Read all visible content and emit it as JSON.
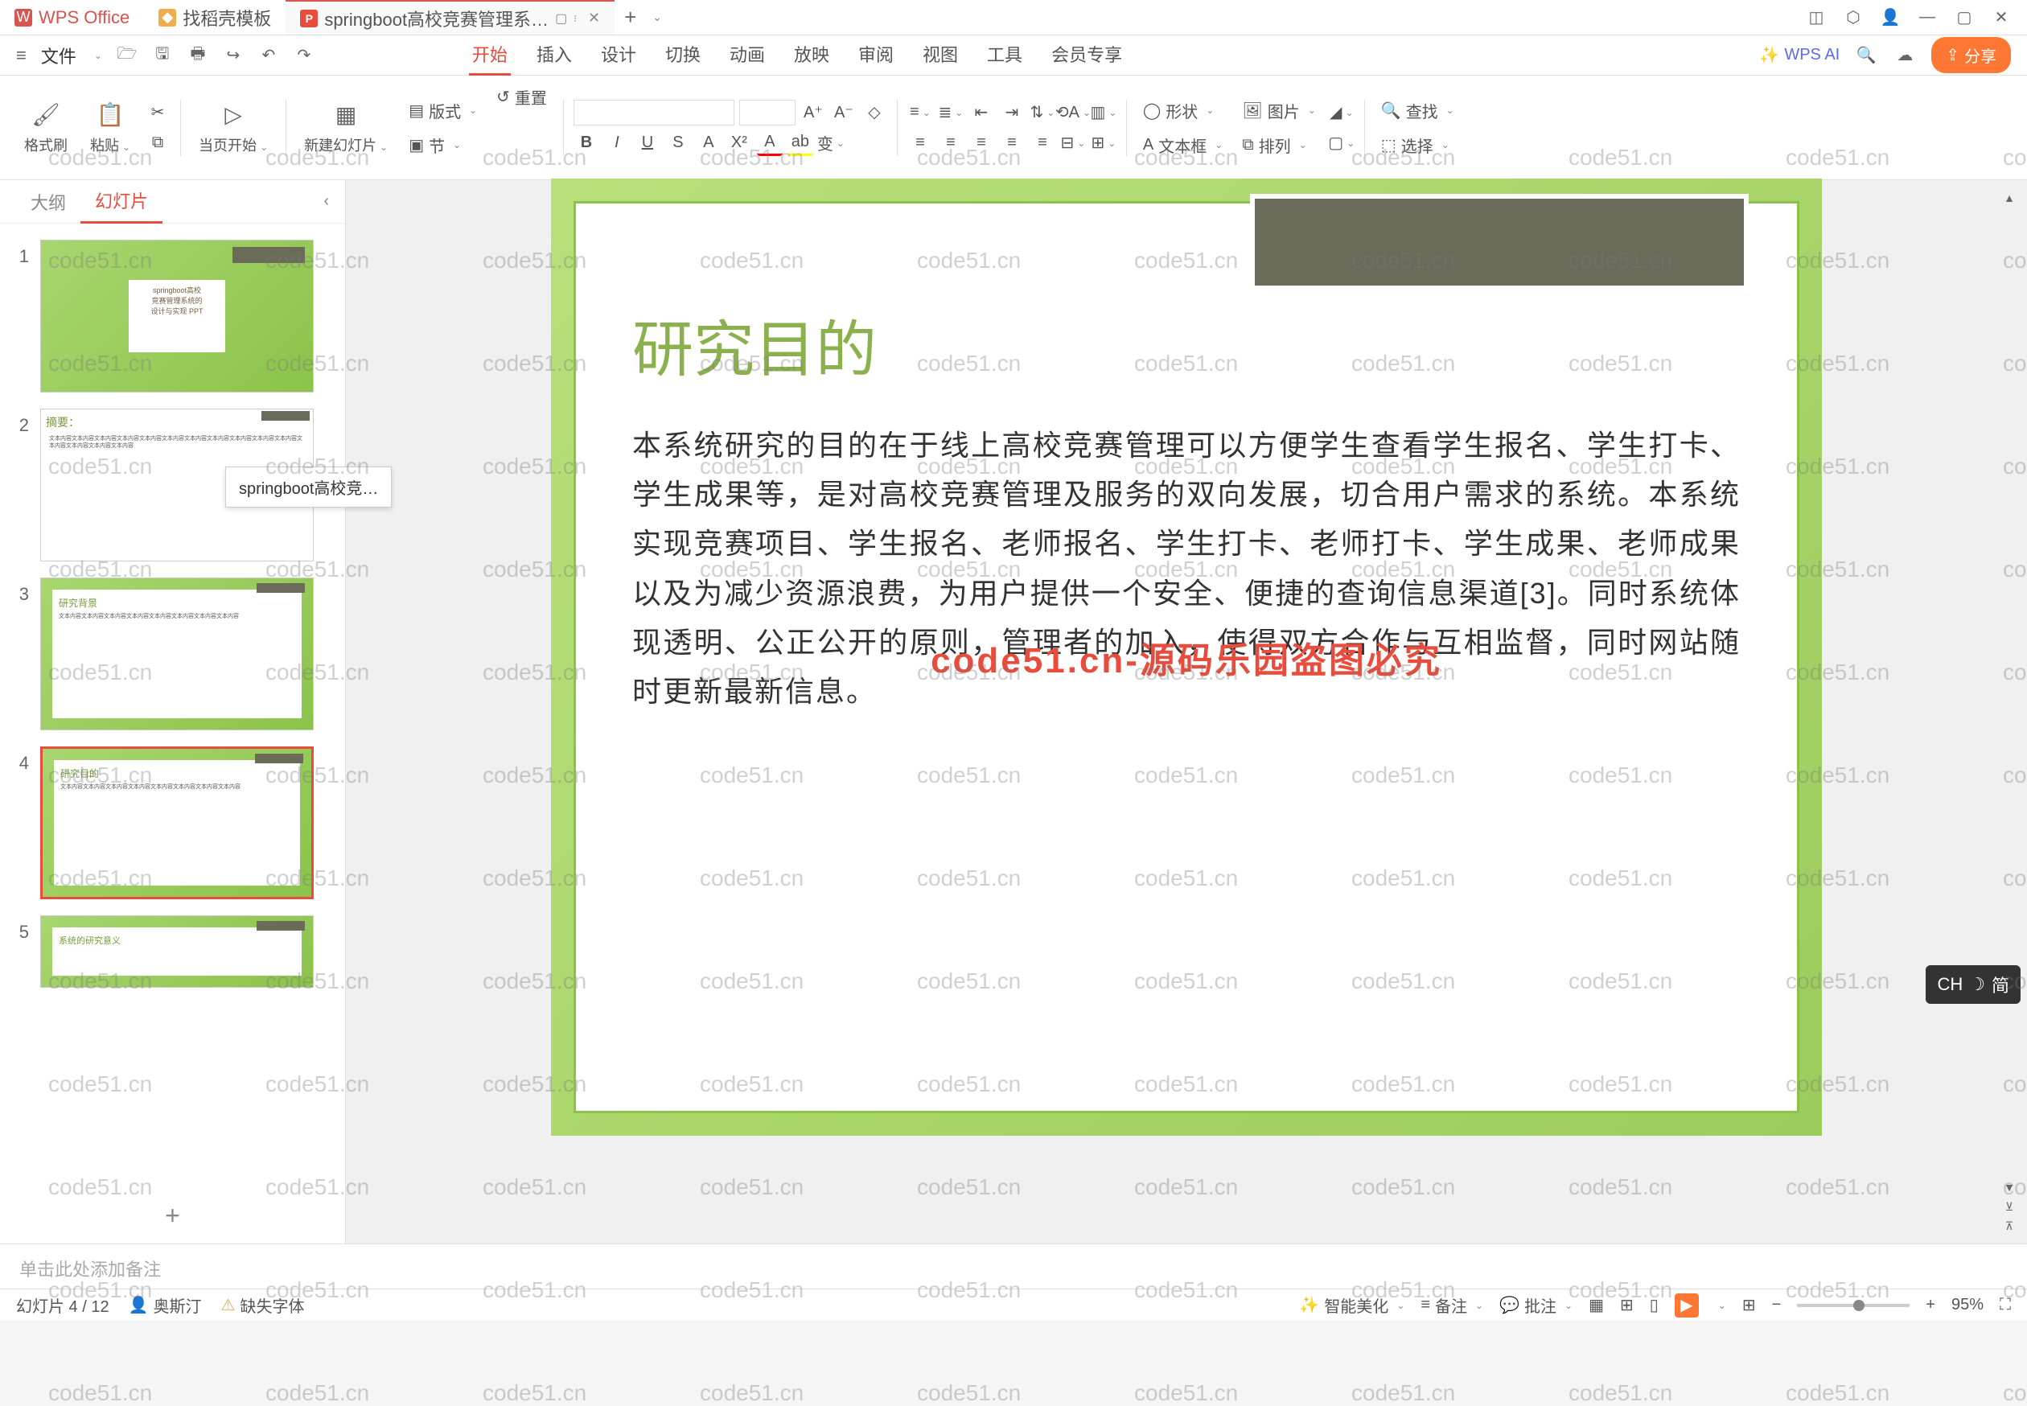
{
  "title_bar": {
    "app_name": "WPS Office",
    "tab_template": "找稻壳模板",
    "tab_doc": "springboot高校竞赛管理系…",
    "tab_doc_tooltip": "springboot高校竞…"
  },
  "menu": {
    "file": "文件",
    "tabs": [
      "开始",
      "插入",
      "设计",
      "切换",
      "动画",
      "放映",
      "审阅",
      "视图",
      "工具",
      "会员专享"
    ],
    "active_tab": "开始",
    "wps_ai": "WPS AI",
    "share": "分享"
  },
  "ribbon": {
    "format_painter": "格式刷",
    "paste": "粘贴",
    "from_current": "当页开始",
    "new_slide": "新建幻灯片",
    "layout": "版式",
    "section": "节",
    "reset": "重置",
    "shape": "形状",
    "picture": "图片",
    "textbox": "文本框",
    "arrange": "排列",
    "find": "查找",
    "select": "选择"
  },
  "panel": {
    "outline_tab": "大纲",
    "slides_tab": "幻灯片",
    "slides": [
      {
        "num": "1",
        "title": ""
      },
      {
        "num": "2",
        "title": "摘要："
      },
      {
        "num": "3",
        "title": "研究背景"
      },
      {
        "num": "4",
        "title": "研究目的"
      },
      {
        "num": "5",
        "title": "系统的研究意义"
      }
    ]
  },
  "slide": {
    "title": "研究目的",
    "body": "本系统研究的目的在于线上高校竞赛管理可以方便学生查看学生报名、学生打卡、学生成果等，是对高校竞赛管理及服务的双向发展，切合用户需求的系统。本系统实现竞赛项目、学生报名、老师报名、学生打卡、老师打卡、学生成果、老师成果以及为减少资源浪费，为用户提供一个安全、便捷的查询信息渠道[3]。同时系统体现透明、公正公开的原则，管理者的加入，使得双方合作与互相监督，同时网站随时更新最新信息。",
    "watermark": "code51.cn-源码乐园盗图必究"
  },
  "notes": {
    "placeholder": "单击此处添加备注"
  },
  "status": {
    "slide_counter": "幻灯片 4 / 12",
    "author": "奥斯汀",
    "missing_font": "缺失字体",
    "smart_beautify": "智能美化",
    "notes_btn": "备注",
    "review_btn": "批注",
    "zoom": "95%"
  },
  "ime": {
    "label": "CH",
    "mode": "简"
  },
  "watermark_text": "code51.cn"
}
